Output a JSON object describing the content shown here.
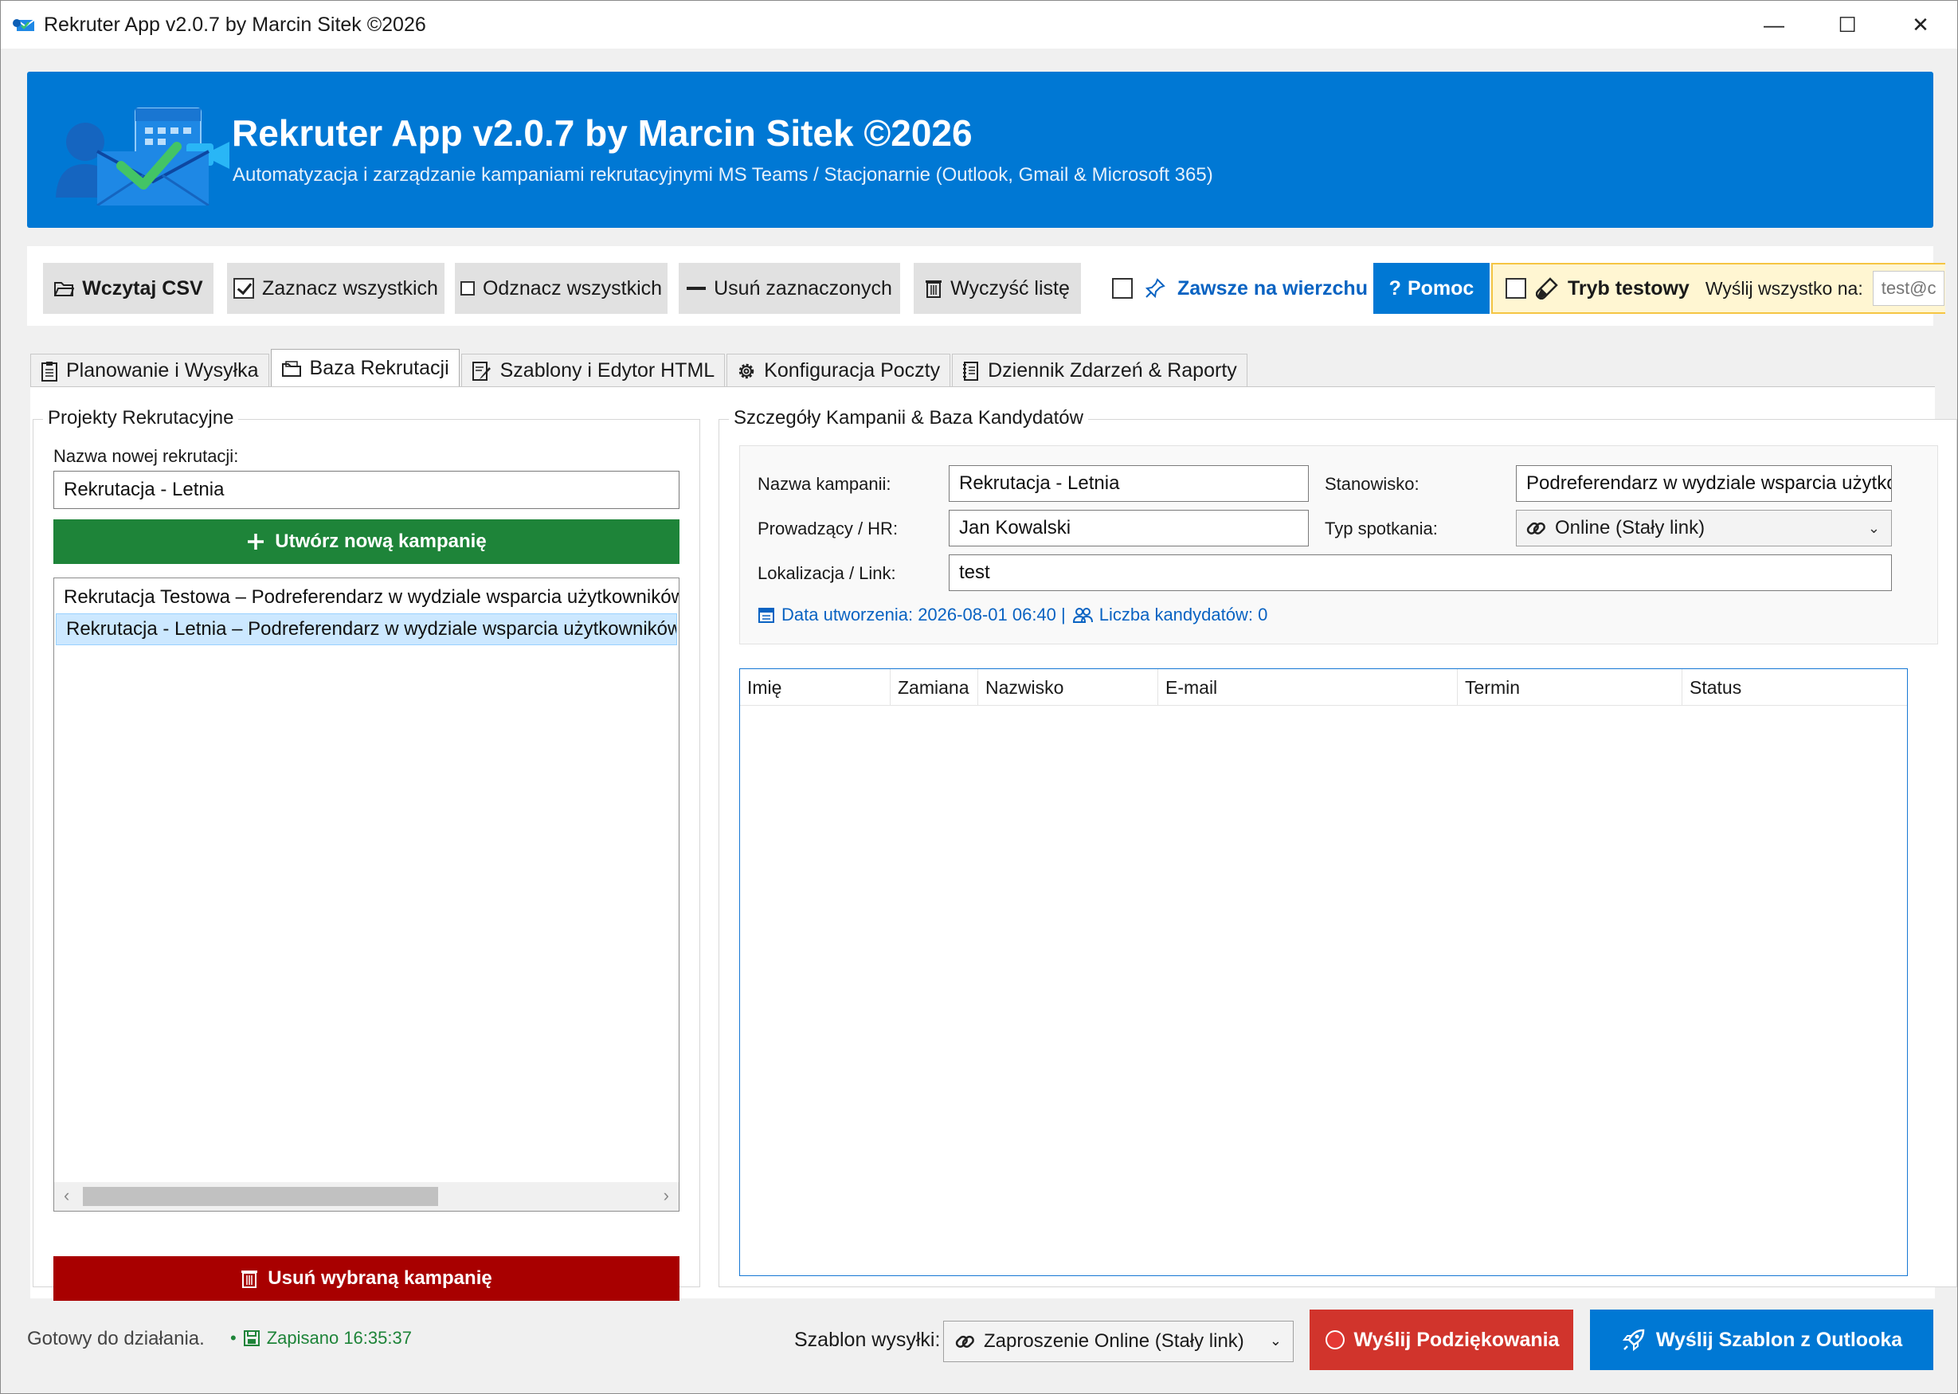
{
  "window": {
    "title": "Rekruter App v2.0.7 by Marcin Sitek ©2026",
    "minimize": "—",
    "maximize": "☐",
    "close": "✕"
  },
  "banner": {
    "title": "Rekruter App v2.0.7 by Marcin Sitek ©2026",
    "subtitle": "Automatyzacja i zarządzanie kampaniami rekrutacyjnymi MS Teams / Stacjonarnie (Outlook, Gmail & Microsoft 365)"
  },
  "toolbar": {
    "load_csv": "Wczytaj CSV",
    "select_all": "Zaznacz wszystkich",
    "deselect_all": "Odznacz wszystkich",
    "remove_selected": "Usuń zaznaczonych",
    "clear_list": "Wyczyść listę",
    "always_on_top": "Zawsze na wierzchu",
    "always_on_top_checked": false,
    "help": "Pomoc",
    "test_mode": "Tryb testowy",
    "test_mode_checked": false,
    "send_all_to": "Wyślij wszystko na:",
    "send_all_placeholder": "test@c"
  },
  "tabs": [
    {
      "label": "Planowanie i Wysyłka",
      "icon": "clipboard-icon",
      "active": false
    },
    {
      "label": "Baza Rekrutacji",
      "icon": "folder-icon",
      "active": true
    },
    {
      "label": "Szablony i Edytor HTML",
      "icon": "document-edit-icon",
      "active": false
    },
    {
      "label": "Konfiguracja Poczty",
      "icon": "gear-icon",
      "active": false
    },
    {
      "label": "Dziennik Zdarzeń & Raporty",
      "icon": "log-icon",
      "active": false
    }
  ],
  "projects": {
    "group_title": "Projekty Rekrutacyjne",
    "new_name_label": "Nazwa nowej rekrutacji:",
    "new_name_value": "Rekrutacja - Letnia",
    "create_button": "Utwórz nową kampanię",
    "items": [
      {
        "label": "Rekrutacja Testowa – Podreferendarz w wydziale wsparcia użytkowników",
        "selected": false
      },
      {
        "label": "Rekrutacja - Letnia – Podreferendarz w wydziale wsparcia użytkowników",
        "selected": true
      }
    ],
    "delete_button": "Usuń wybraną kampanię"
  },
  "details": {
    "group_title": "Szczegóły Kampanii & Baza Kandydatów",
    "campaign_name_label": "Nazwa kampanii:",
    "campaign_name_value": "Rekrutacja - Letnia",
    "position_label": "Stanowisko:",
    "position_value": "Podreferendarz w wydziale wsparcia użytkowników",
    "hr_label": "Prowadzący / HR:",
    "hr_value": "Jan Kowalski",
    "meeting_type_label": "Typ spotkania:",
    "meeting_type_value": "Online (Stały link)",
    "location_label": "Lokalizacja / Link:",
    "location_value": "test",
    "created_info": "Data utworzenia: 2026-08-01 06:40 |",
    "candidates_info": "Liczba kandydatów: 0"
  },
  "grid": {
    "columns": [
      "Imię",
      "Zamiana",
      "Nazwisko",
      "E-mail",
      "Termin",
      "Status"
    ],
    "rows": []
  },
  "statusbar": {
    "status": "Gotowy do działania.",
    "bullet": "•",
    "saved": "Zapisano 16:35:37",
    "template_label": "Szablon wysyłki:",
    "template_value": "Zaproszenie Online (Stały link)",
    "send_thanks": "Wyślij Podziękowania",
    "send_outlook": "Wyślij Szablon z Outlooka"
  },
  "colors": {
    "accent": "#0078d4",
    "green": "#1e8439",
    "dark_red": "#a80000",
    "red": "#d1342c",
    "test_bg": "#fff6d2"
  }
}
